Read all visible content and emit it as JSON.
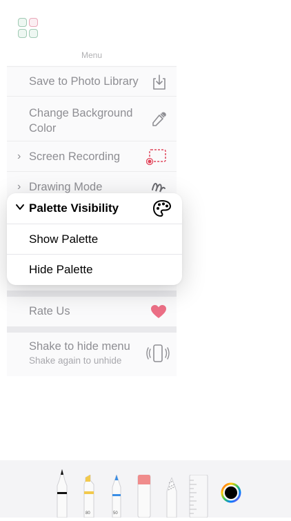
{
  "app_icon": {
    "name": "apps-grid-icon"
  },
  "menu": {
    "header": "Menu",
    "items": [
      {
        "label": "Save to Photo Library",
        "icon": "save-to-library-icon"
      },
      {
        "label": "Change Background Color",
        "icon": "eyedropper-icon"
      },
      {
        "label": "Screen Recording",
        "icon": "screen-recording-icon",
        "expandable": true
      },
      {
        "label": "Drawing Mode",
        "icon": "squiggle-icon",
        "expandable": true
      },
      {
        "label": "Rate Us",
        "icon": "heart-icon"
      },
      {
        "label": "Shake to hide menu",
        "sublabel": "Shake again to unhide",
        "icon": "phone-shake-icon"
      }
    ]
  },
  "palette_menu": {
    "title": "Palette Visibility",
    "title_icon": "palette-icon",
    "options": [
      {
        "label": "Show Palette"
      },
      {
        "label": "Hide Palette"
      }
    ]
  },
  "toolbar": {
    "tools": [
      {
        "name": "pen",
        "icon": "pen-tool-icon"
      },
      {
        "name": "marker",
        "icon": "marker-tool-icon",
        "number": "80"
      },
      {
        "name": "pencil-blue",
        "icon": "pencil-tool-icon",
        "number": "50"
      },
      {
        "name": "eraser",
        "icon": "eraser-tool-icon"
      },
      {
        "name": "lasso",
        "icon": "lasso-tool-icon"
      },
      {
        "name": "ruler",
        "icon": "ruler-tool-icon"
      },
      {
        "name": "color-picker",
        "icon": "color-wheel-icon"
      }
    ],
    "selected_color": "#000000"
  },
  "colors": {
    "accent_red": "#e0445a",
    "heart": "#ec6f86",
    "marker_yellow": "#f2c94c",
    "pencil_blue": "#3a8ee6",
    "eraser_pink": "#f08c8c"
  }
}
